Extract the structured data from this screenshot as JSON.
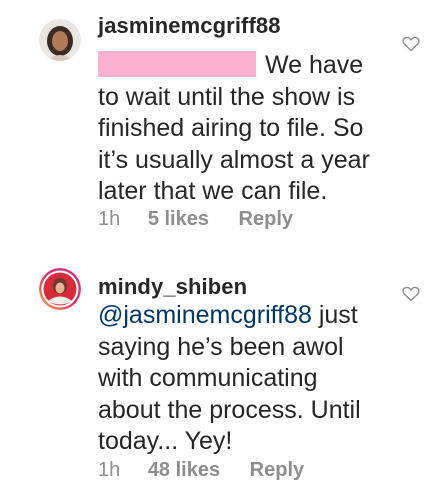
{
  "comments": [
    {
      "username": "jasminemcgriff88",
      "text_after_redaction": "We have",
      "lines": [
        "to wait until the show is",
        "finished airing to file. So",
        "it’s usually almost a year",
        "later that we can file."
      ],
      "time": "1h",
      "likes": "5 likes",
      "reply": "Reply",
      "colors": {
        "redaction": "#fbb1cf"
      }
    },
    {
      "username": "mindy_shiben",
      "mention": "@jasminemcgriff88",
      "first_line_rest": " just",
      "lines": [
        "saying he’s been awol",
        "with communicating",
        "about the process. Until",
        "today... Yey!"
      ],
      "time": "1h",
      "likes": "48 likes",
      "reply": "Reply",
      "colors": {
        "mention": "#00376b"
      }
    }
  ],
  "icons": {
    "like": "heart-outline-icon",
    "avatar_ring": "story-ring"
  }
}
